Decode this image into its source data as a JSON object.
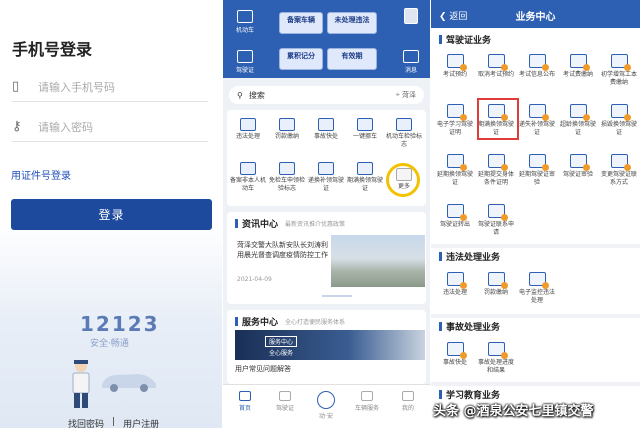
{
  "login": {
    "title": "手机号登录",
    "phone_placeholder": "请输入手机号码",
    "password_placeholder": "请输入密码",
    "cert_login": "用证件号登录",
    "login_button": "登录",
    "logo": "12123",
    "slogan": "安全·畅通",
    "find_password": "找回密码",
    "separator": "|",
    "register": "用户注册"
  },
  "home": {
    "header_left": [
      {
        "label": "机动车"
      },
      {
        "label": "驾驶证"
      }
    ],
    "header_right": [
      {
        "label": ""
      },
      {
        "label": "消息"
      }
    ],
    "cards": [
      {
        "text": "备案车辆"
      },
      {
        "text": "未处理违法"
      },
      {
        "text": "累积记分"
      },
      {
        "text": "有效期"
      }
    ],
    "search_placeholder": "搜索",
    "city": "菏泽",
    "grid": [
      {
        "label": "违法处理"
      },
      {
        "label": "罚款缴纳"
      },
      {
        "label": "事故快处"
      },
      {
        "label": "一键挪车"
      },
      {
        "label": "机动车检验标志"
      },
      {
        "label": "备案非本人机动车"
      },
      {
        "label": "免检车申领检验标志"
      },
      {
        "label": "递换补领驾驶证"
      },
      {
        "label": "期满换领驾驶证"
      },
      {
        "label": "更多"
      }
    ],
    "news_section": "资讯中心",
    "news_sub": "最新资讯推介优惠政策",
    "news_text": "菏泽交警大队新安队长刘涛利用晨光督查调度疫情防控工作",
    "news_date": "2021-04-09",
    "service_section": "服务中心",
    "service_sub": "全心打造便民服务体系",
    "service_tag": "服务中心",
    "service_banner": "全心服务",
    "service_text": "用户常见问题解答",
    "tabs": [
      {
        "label": "首页"
      },
      {
        "label": "驾驶证"
      },
      {
        "label": "动·安"
      },
      {
        "label": "车辆服务"
      },
      {
        "label": "我的"
      }
    ]
  },
  "business": {
    "back": "返回",
    "title": "业务中心",
    "section1": "驾驶证业务",
    "items1": [
      {
        "label": "考试预约"
      },
      {
        "label": "取消考试预约"
      },
      {
        "label": "考试信息公布"
      },
      {
        "label": "考试费缴纳"
      },
      {
        "label": "初学增驾工本费缴纳"
      },
      {
        "label": "电子学习驾驶证明"
      },
      {
        "label": "期满换领驾驶证"
      },
      {
        "label": "递失补领驾驶证"
      },
      {
        "label": "超龄换领驾驶证"
      },
      {
        "label": "损毁换领驾驶证"
      },
      {
        "label": "延期换领驾驶证"
      },
      {
        "label": "延期提交身体条件证明"
      },
      {
        "label": "延期驾驶证审验"
      },
      {
        "label": "驾驶证审验"
      },
      {
        "label": "变更驾驶证联系方式"
      },
      {
        "label": "驾驶证转出"
      },
      {
        "label": "驾驶证联系申请"
      }
    ],
    "section2": "违法处理业务",
    "items2": [
      {
        "label": "违法处理"
      },
      {
        "label": "罚款缴纳"
      },
      {
        "label": "电子监控违法处理"
      }
    ],
    "section3": "事故处理业务",
    "items3": [
      {
        "label": "事故快处"
      },
      {
        "label": "事故处理进度和结果"
      }
    ],
    "section4": "学习教育业务"
  },
  "watermark": "头条 @酒泉公安七里镇交警",
  "colors": {
    "brand_blue": "#2d5fb2",
    "highlight_yellow": "#f2c200",
    "highlight_red": "#e23b3b"
  }
}
